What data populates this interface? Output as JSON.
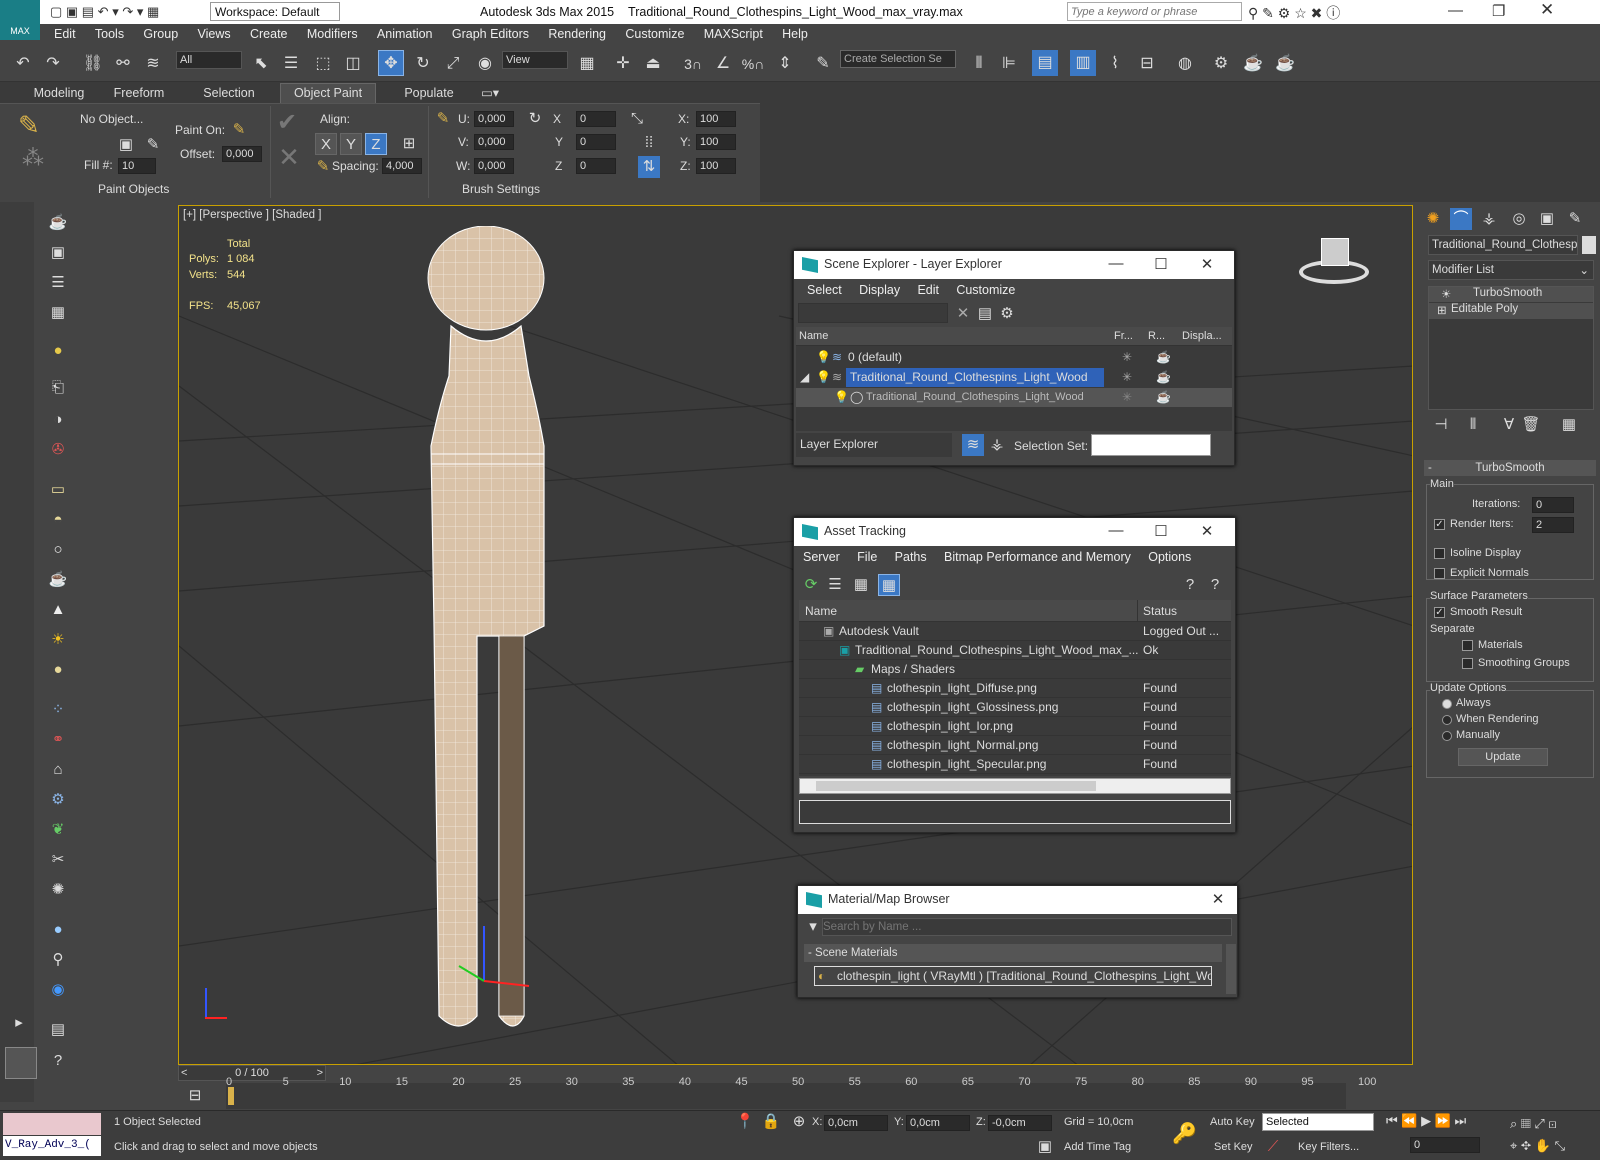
{
  "titlebar": {
    "app": "Autodesk 3ds Max  2015",
    "file": "Traditional_Round_Clothespins_Light_Wood_max_vray.max",
    "workspace": "Workspace: Default",
    "search_placeholder": "Type a keyword or phrase"
  },
  "menu": [
    "Edit",
    "Tools",
    "Group",
    "Views",
    "Create",
    "Modifiers",
    "Animation",
    "Graph Editors",
    "Rendering",
    "Customize",
    "MAXScript",
    "Help"
  ],
  "toolbar": {
    "filter": "All",
    "refcoord": "View",
    "selset_placeholder": "Create Selection Se",
    "snap3": "3",
    "snap_pct": "%"
  },
  "ribbon": {
    "tabs": [
      "Modeling",
      "Freeform",
      "Selection",
      "Object Paint",
      "Populate"
    ],
    "active_tab": "Object Paint",
    "no_object": "No Object...",
    "paint_on": "Paint On:",
    "offset_label": "Offset:",
    "offset_value": "0,000",
    "fill_label": "Fill #:",
    "fill_value": "10",
    "align_label": "Align:",
    "x": "X",
    "y": "Y",
    "z": "Z",
    "spacing_label": "Spacing:",
    "spacing_value": "4,000",
    "u_label": "U:",
    "u_value": "0,000",
    "v_label": "V:",
    "v_value": "0,000",
    "w_label": "W:",
    "w_value": "0,000",
    "rx_label": "X",
    "rx_value": "0",
    "ry_label": "Y",
    "ry_value": "0",
    "rz_label": "Z",
    "rz_value": "0",
    "sx_label": "X:",
    "sx_value": "100",
    "sy_label": "Y:",
    "sy_value": "100",
    "sz_label": "Z:",
    "sz_value": "100",
    "group_paint": "Paint Objects",
    "group_brush": "Brush Settings"
  },
  "viewport": {
    "label": "[+] [Perspective ] [Shaded ]",
    "total": "Total",
    "polys_label": "Polys:",
    "polys": "1 084",
    "verts_label": "Verts:",
    "verts": "544",
    "fps_label": "FPS:",
    "fps": "45,067"
  },
  "scene_explorer": {
    "title": "Scene Explorer - Layer Explorer",
    "menu": [
      "Select",
      "Display",
      "Edit",
      "Customize"
    ],
    "columns": [
      "Name",
      "Fr...",
      "R...",
      "Displa..."
    ],
    "rows": [
      {
        "name": "0 (default)"
      },
      {
        "name": "Traditional_Round_Clothespins_Light_Wood"
      },
      {
        "name": "Traditional_Round_Clothespins_Light_Wood"
      }
    ],
    "footer_mode": "Layer Explorer",
    "selection_set": "Selection Set:"
  },
  "asset_tracking": {
    "title": "Asset Tracking",
    "menu": [
      "Server",
      "File",
      "Paths",
      "Bitmap Performance and Memory",
      "Options"
    ],
    "columns": [
      "Name",
      "Status"
    ],
    "rows": [
      {
        "name": "Autodesk Vault",
        "status": "Logged Out ..."
      },
      {
        "name": "Traditional_Round_Clothespins_Light_Wood_max_...",
        "status": "Ok"
      },
      {
        "name": "Maps / Shaders",
        "status": ""
      },
      {
        "name": "clothespin_light_Diffuse.png",
        "status": "Found"
      },
      {
        "name": "clothespin_light_Glossiness.png",
        "status": "Found"
      },
      {
        "name": "clothespin_light_Ior.png",
        "status": "Found"
      },
      {
        "name": "clothespin_light_Normal.png",
        "status": "Found"
      },
      {
        "name": "clothespin_light_Specular.png",
        "status": "Found"
      }
    ]
  },
  "material_browser": {
    "title": "Material/Map Browser",
    "search_placeholder": "Search by Name ...",
    "section": "- Scene Materials",
    "item": "clothespin_light ( VRayMtl ) [Traditional_Round_Clothespins_Light_Wood]"
  },
  "command_panel": {
    "object_name": "Traditional_Round_Clothespir",
    "modifier_list": "Modifier List",
    "stack": [
      "TurboSmooth",
      "Editable Poly"
    ],
    "rollout": "TurboSmooth",
    "main": "Main",
    "iterations_label": "Iterations:",
    "iterations": "0",
    "render_iters_label": "Render Iters:",
    "render_iters": "2",
    "isoline": "Isoline Display",
    "explicit": "Explicit Normals",
    "surface": "Surface Parameters",
    "smooth": "Smooth Result",
    "separate": "Separate",
    "materials": "Materials",
    "smoothing": "Smoothing Groups",
    "update_options": "Update Options",
    "always": "Always",
    "when_rendering": "When Rendering",
    "manually": "Manually",
    "update": "Update"
  },
  "timeline": {
    "frame": "0 / 100",
    "ticks": [
      "0",
      "5",
      "10",
      "15",
      "20",
      "25",
      "30",
      "35",
      "40",
      "45",
      "50",
      "55",
      "60",
      "65",
      "70",
      "75",
      "80",
      "85",
      "90",
      "95",
      "100"
    ]
  },
  "status": {
    "script": "V_Ray_Adv_3_(",
    "selected": "1 Object Selected",
    "prompt": "Click and drag to select and move objects",
    "x_label": "X:",
    "x": "0,0cm",
    "y_label": "Y:",
    "y": "0,0cm",
    "z_label": "Z:",
    "z": "-0,0cm",
    "grid": "Grid = 10,0cm",
    "auto_key": "Auto Key",
    "set_key": "Set Key",
    "key_mode": "Selected",
    "key_filters": "Key Filters...",
    "add_time_tag": "Add Time Tag",
    "frame_value": "0"
  }
}
